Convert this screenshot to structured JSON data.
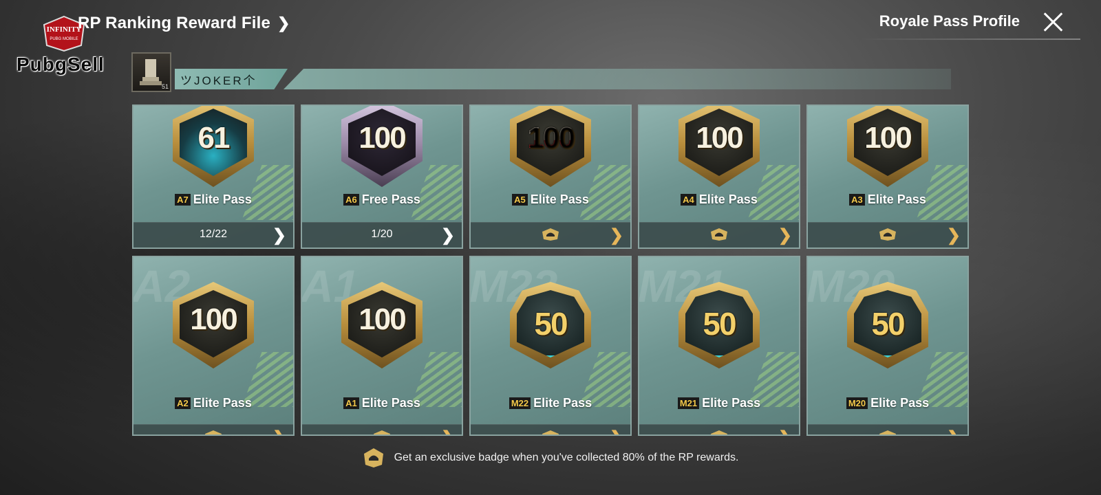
{
  "header": {
    "title": "RP Ranking Reward File",
    "title_chevron": "❯",
    "profile_link": "Royale Pass Profile"
  },
  "watermark": {
    "logo_text": "INFINITY",
    "logo_sub": "PUBG MOBILE",
    "brand": "PubgSell"
  },
  "player": {
    "name": "ツJOKER个",
    "avatar_level": "51"
  },
  "cards": [
    {
      "season": "A7",
      "pass": "Elite Pass",
      "rank": "61",
      "progress": "12/22",
      "style": "cyan"
    },
    {
      "season": "A6",
      "pass": "Free Pass",
      "rank": "100",
      "progress": "1/20",
      "style": "silver"
    },
    {
      "season": "A5",
      "pass": "Elite Pass",
      "rank": "100",
      "progress": "",
      "style": "redtext"
    },
    {
      "season": "A4",
      "pass": "Elite Pass",
      "rank": "100",
      "progress": "",
      "style": "gold"
    },
    {
      "season": "A3",
      "pass": "Elite Pass",
      "rank": "100",
      "progress": "",
      "style": "gold"
    },
    {
      "season": "A2",
      "pass": "Elite Pass",
      "rank": "100",
      "progress": "",
      "style": "gold",
      "bg": "A2"
    },
    {
      "season": "A1",
      "pass": "Elite Pass",
      "rank": "100",
      "progress": "",
      "style": "gold",
      "bg": "A1"
    },
    {
      "season": "M22",
      "pass": "Elite Pass",
      "rank": "50",
      "progress": "",
      "style": "b50",
      "bg": "M22"
    },
    {
      "season": "M21",
      "pass": "Elite Pass",
      "rank": "50",
      "progress": "",
      "style": "b50",
      "bg": "M21"
    },
    {
      "season": "M20",
      "pass": "Elite Pass",
      "rank": "50",
      "progress": "",
      "style": "b50",
      "bg": "M20"
    }
  ],
  "footer_note": "Get an exclusive badge when you've collected 80% of the RP rewards."
}
